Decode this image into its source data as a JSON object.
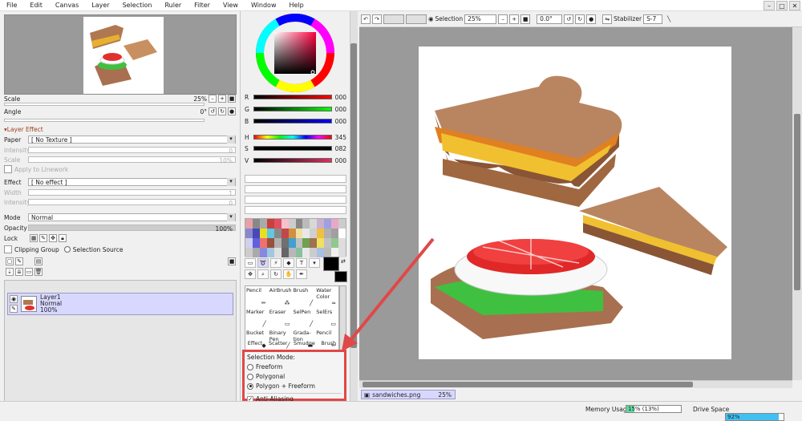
{
  "menu": [
    "File",
    "Edit",
    "Canvas",
    "Layer",
    "Selection",
    "Ruler",
    "Filter",
    "View",
    "Window",
    "Help"
  ],
  "window_controls": [
    "–",
    "□",
    "✕"
  ],
  "navigator": {
    "scale_label": "Scale",
    "scale_value": "25%",
    "angle_label": "Angle",
    "angle_value": "0°"
  },
  "layer_effect": {
    "header": "Layer Effect",
    "paper_label": "Paper",
    "paper_value": "[ No Texture ]",
    "intensity_label": "Intensity",
    "intensity_value": "0",
    "scale_label": "Scale",
    "scale_value": "10%",
    "apply_linework": "Apply to Linework",
    "effect_label": "Effect",
    "effect_value": "[ No effect ]",
    "width_label": "Width",
    "width_value": "1",
    "intensity2_label": "Intensity",
    "intensity2_value": "0"
  },
  "layer_props": {
    "mode_label": "Mode",
    "mode_value": "Normal",
    "opacity_label": "Opacity",
    "opacity_value": "100%",
    "lock_label": "Lock",
    "clipping_group": "Clipping Group",
    "selection_source": "Selection Source"
  },
  "layer": {
    "name": "Layer1",
    "mode": "Normal",
    "opacity": "100%"
  },
  "color": {
    "channels": [
      {
        "label": "R",
        "value": "000",
        "gradient": "linear-gradient(90deg,#000,#f00)"
      },
      {
        "label": "G",
        "value": "000",
        "gradient": "linear-gradient(90deg,#000,#0f0)"
      },
      {
        "label": "B",
        "value": "000",
        "gradient": "linear-gradient(90deg,#000,#00f)"
      },
      {
        "label": "H",
        "value": "345",
        "gradient": "linear-gradient(90deg,#f00,#ff0,#0f0,#0ff,#00f,#f0f,#f00)"
      },
      {
        "label": "S",
        "value": "082",
        "gradient": "linear-gradient(90deg,#000,#000)"
      },
      {
        "label": "V",
        "value": "000",
        "gradient": "linear-gradient(90deg,#000,#e03060)"
      }
    ],
    "primary": "#000000",
    "secondary": "#000000"
  },
  "swatches": [
    "#e8a0a8",
    "#888",
    "#aaa",
    "#c84040",
    "#e05060",
    "#f8c0c8",
    "#ccc",
    "#888",
    "#bbb",
    "#d8d8d8",
    "#c8b0d0",
    "#a0a0e0",
    "#e8a8c8",
    "#ccc",
    "#8888cc",
    "#4848b8",
    "#e8e020",
    "#60c8e0",
    "#888",
    "#c04848",
    "#d09040",
    "#f0e0a0",
    "#e8e8e8",
    "#d0d0d0",
    "#f0c040",
    "#b0b0b0",
    "#a0a0a0",
    "#fff",
    "#d0d0f0",
    "#6060e0",
    "#f07070",
    "#9a5038",
    "#b0b0b0",
    "#707070",
    "#40a0d0",
    "#c0c0c0",
    "#70a050",
    "#a07050",
    "#f0e060",
    "#c0c0c0",
    "#90c890",
    "#ddd",
    "#ccc",
    "#aaa",
    "#8888e0",
    "#a0c8e0",
    "#e0e0e0",
    "#666",
    "#b8b8b8",
    "#88c0a0",
    "#e8e8e8",
    "#ccc",
    "#aac0e0",
    "#bbb",
    "#f0f0f0",
    "#ddd"
  ],
  "brushes": [
    {
      "label": "Pencil",
      "icon": "✏"
    },
    {
      "label": "AirBrush",
      "icon": "⁂"
    },
    {
      "label": "Brush",
      "icon": "╱"
    },
    {
      "label": "Water Color",
      "icon": "≈"
    },
    {
      "label": "Marker",
      "icon": "╱"
    },
    {
      "label": "Eraser",
      "icon": "▭"
    },
    {
      "label": "SelPen",
      "icon": "╱"
    },
    {
      "label": "SelErs",
      "icon": "▭"
    },
    {
      "label": "Bucket",
      "icon": "◆"
    },
    {
      "label": "Binary Pen",
      "icon": "╱"
    },
    {
      "label": "Grada-tion",
      "icon": "▬"
    },
    {
      "label": "Pencil",
      "icon": "✏"
    }
  ],
  "brush_row4": [
    "Effect",
    "Scatter",
    "Smudge",
    "Brush"
  ],
  "selection_mode": {
    "title": "Selection Mode:",
    "options": [
      "Freeform",
      "Polygonal",
      "Polygon + Freeform"
    ],
    "selected": 2,
    "anti_aliasing": "Anti-Aliasing"
  },
  "canvas_toolbar": {
    "selection_label": "Selection",
    "zoom": "25%",
    "angle": "0.0°",
    "stabilizer_label": "Stabilizer",
    "stabilizer_value": "S-7"
  },
  "document": {
    "name": "sandwiches.png",
    "zoom": "25%"
  },
  "status": {
    "memory_label": "Memory Usage",
    "memory_value": "15% (13%)",
    "memory_fraction": 0.15,
    "drive_label": "Drive Space",
    "drive_value": "92%",
    "drive_fraction": 0.92
  }
}
